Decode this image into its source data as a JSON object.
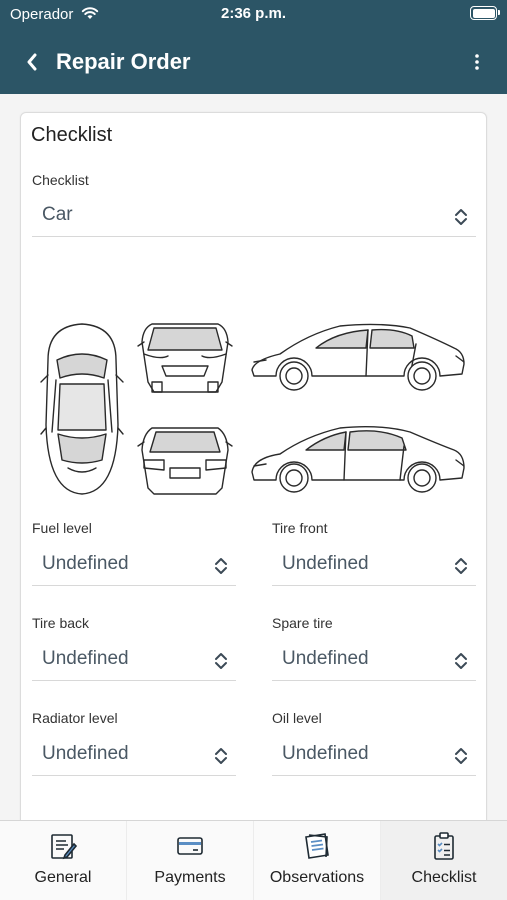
{
  "status_bar": {
    "carrier": "Operador",
    "time": "2:36 p.m."
  },
  "header": {
    "title": "Repair Order"
  },
  "card": {
    "title": "Checklist",
    "checklist": {
      "label": "Checklist",
      "value": "Car"
    },
    "fields": [
      {
        "label": "Fuel level",
        "value": "Undefined"
      },
      {
        "label": "Tire front",
        "value": "Undefined"
      },
      {
        "label": "Tire back",
        "value": "Undefined"
      },
      {
        "label": "Spare tire",
        "value": "Undefined"
      },
      {
        "label": "Radiator level",
        "value": "Undefined"
      },
      {
        "label": "Oil level",
        "value": "Undefined"
      }
    ]
  },
  "tabs": [
    {
      "label": "General",
      "icon": "general-icon"
    },
    {
      "label": "Payments",
      "icon": "payments-icon"
    },
    {
      "label": "Observations",
      "icon": "observations-icon"
    },
    {
      "label": "Checklist",
      "icon": "checklist-icon"
    }
  ],
  "colors": {
    "header": "#2c5566",
    "active_tab_bg": "#f0f0f0"
  }
}
